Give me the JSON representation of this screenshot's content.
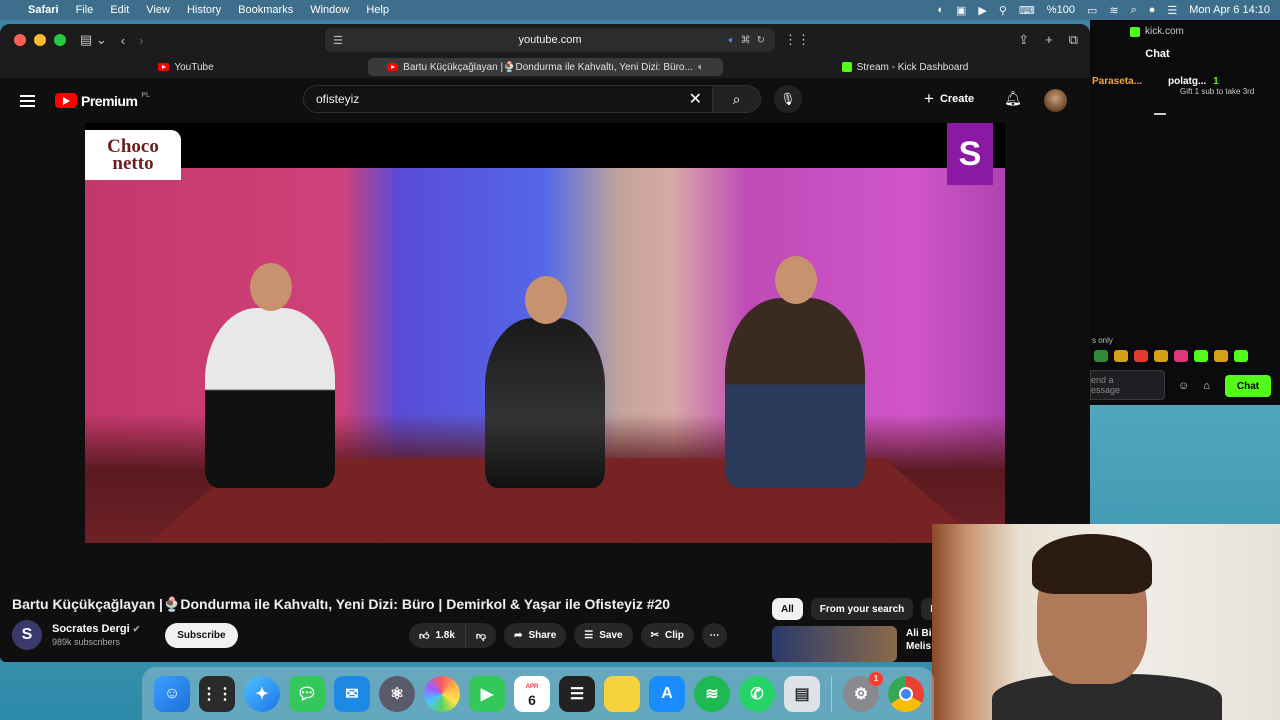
{
  "menubar": {
    "app": "Safari",
    "items": [
      "File",
      "Edit",
      "View",
      "History",
      "Bookmarks",
      "Window",
      "Help"
    ],
    "battery": "%100",
    "datetime": "Mon Apr 6  14:10"
  },
  "safari": {
    "address": "youtube.com",
    "tabs": [
      {
        "label": "YouTube"
      },
      {
        "label": "Bartu Küçükçağlayan |🍨Dondurma ile Kahvaltı, Yeni Dizi: Büro..."
      },
      {
        "label": "Stream - Kick Dashboard"
      }
    ]
  },
  "youtube": {
    "logo": "Premium",
    "logo_region": "PL",
    "search_value": "ofisteyiz",
    "create_label": "Create",
    "video": {
      "sponsor": "Choco netto",
      "channel_logo": "S"
    },
    "title": "Bartu Küçükçağlayan |🍨Dondurma ile Kahvaltı, Yeni Dizi: Büro | Demirkol & Yaşar ile Ofisteyiz #20",
    "channel": {
      "avatar_letter": "S",
      "name": "Socrates Dergi",
      "subscribers": "989k subscribers",
      "subscribe_label": "Subscribe"
    },
    "actions": {
      "likes": "1.8k",
      "share": "Share",
      "save": "Save",
      "clip": "Clip"
    },
    "chips": [
      "All",
      "From your search",
      "Fi"
    ],
    "recommendation_title": "Ali Bi\nMelis"
  },
  "kick": {
    "url": "kick.com",
    "chat_title": "Chat",
    "msg1_user": "Paraseta...",
    "msg2_user": "polatg...",
    "msg2_count": "1",
    "msg2_text": "Gift 1 sub to take 3rd",
    "followers_only": "s only",
    "input_placeholder": "end a\nessage",
    "chat_button": "Chat"
  },
  "dock": {
    "calendar_month": "APR",
    "calendar_day": "6",
    "settings_badge": "1"
  },
  "colors": {
    "yt_red": "#ff0000",
    "kick_green": "#53fc18",
    "yt_bg": "#0f0f0f"
  }
}
